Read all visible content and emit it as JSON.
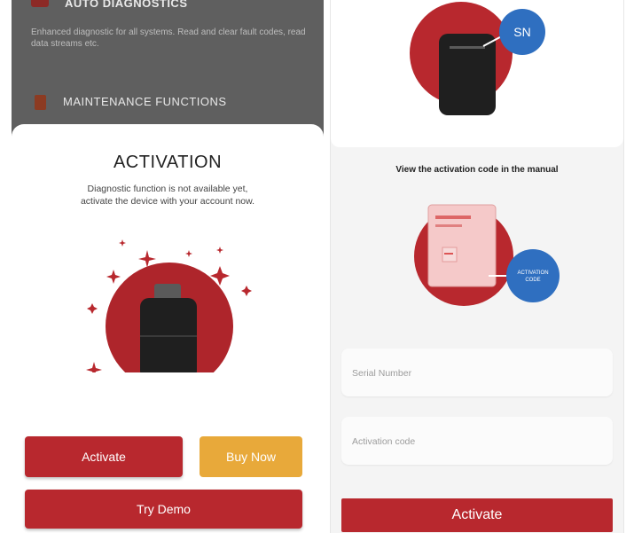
{
  "left_screen": {
    "top_item": {
      "title": "AUTO DIAGNOSTICS",
      "description": "Enhanced diagnostic for all systems. Read and clear fault codes, read data streams etc."
    },
    "maintenance": {
      "label": "MAINTENANCE FUNCTIONS"
    },
    "sheet": {
      "title": "ACTIVATION",
      "description_line1": "Diagnostic function is not available yet,",
      "description_line2": "activate the device with your account now.",
      "activate_label": "Activate",
      "buy_now_label": "Buy Now",
      "try_demo_label": "Try Demo"
    }
  },
  "right_screen": {
    "sn_badge": "SN",
    "manual_text": "View the activation code in the manual",
    "code_badge_line1": "ACTIVATION",
    "code_badge_line2": "CODE",
    "serial_placeholder": "Serial Number",
    "code_placeholder": "Activation code",
    "activate_label": "Activate"
  },
  "colors": {
    "brand_red": "#b8282e",
    "buy_yellow": "#e8a93a",
    "badge_blue": "#2f6fc0",
    "overlay_gray": "#5f5f5f"
  }
}
